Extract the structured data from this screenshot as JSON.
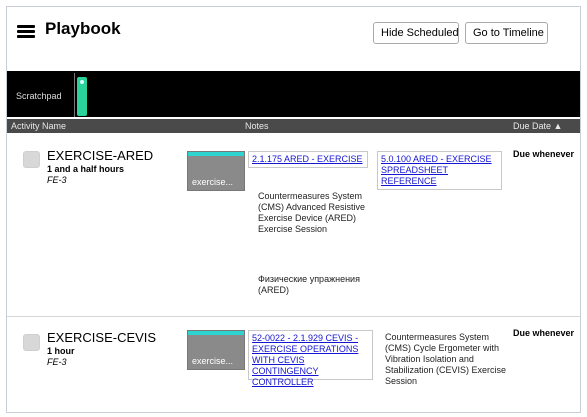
{
  "header": {
    "title": "Playbook",
    "hide_scheduled": "Hide Scheduled",
    "go_to_timeline": "Go to Timeline"
  },
  "scratchpad": {
    "label": "Scratchpad"
  },
  "columns": {
    "activity_name": "Activity Name",
    "notes": "Notes",
    "due_date": "Due Date ▲"
  },
  "activities": [
    {
      "name": "EXERCISE-ARED",
      "duration": "1 and a half hours",
      "location": "FE-3",
      "tile_label": "exercise...",
      "link1": "2.1.175 ARED - EXERCISE",
      "link2": "5.0.100 ARED - EXERCISE SPREADSHEET REFERENCE",
      "note_en": "Countermeasures System (CMS) Advanced Resistive Exercise Device (ARED) Exercise Session",
      "note_ru": "Физические упражнения (ARED)",
      "due": "Due whenever"
    },
    {
      "name": "EXERCISE-CEVIS",
      "duration": "1 hour",
      "location": "FE-3",
      "tile_label": "exercise...",
      "link1": "52-0022 - 2.1.929 CEVIS - EXERCISE OPERATIONS WITH CEVIS CONTINGENCY CONTROLLER",
      "note_en": "Countermeasures System (CMS) Cycle Ergometer with Vibration Isolation and Stabilization (CEVIS) Exercise Session",
      "due": "Due whenever"
    }
  ],
  "colors": {
    "background": "#ffffff",
    "band": "#000000",
    "column_header": "#4a4a4a",
    "accent_teal": "#2fd3cf",
    "marker_green": "#2ad39a",
    "link": "#1515d2"
  }
}
